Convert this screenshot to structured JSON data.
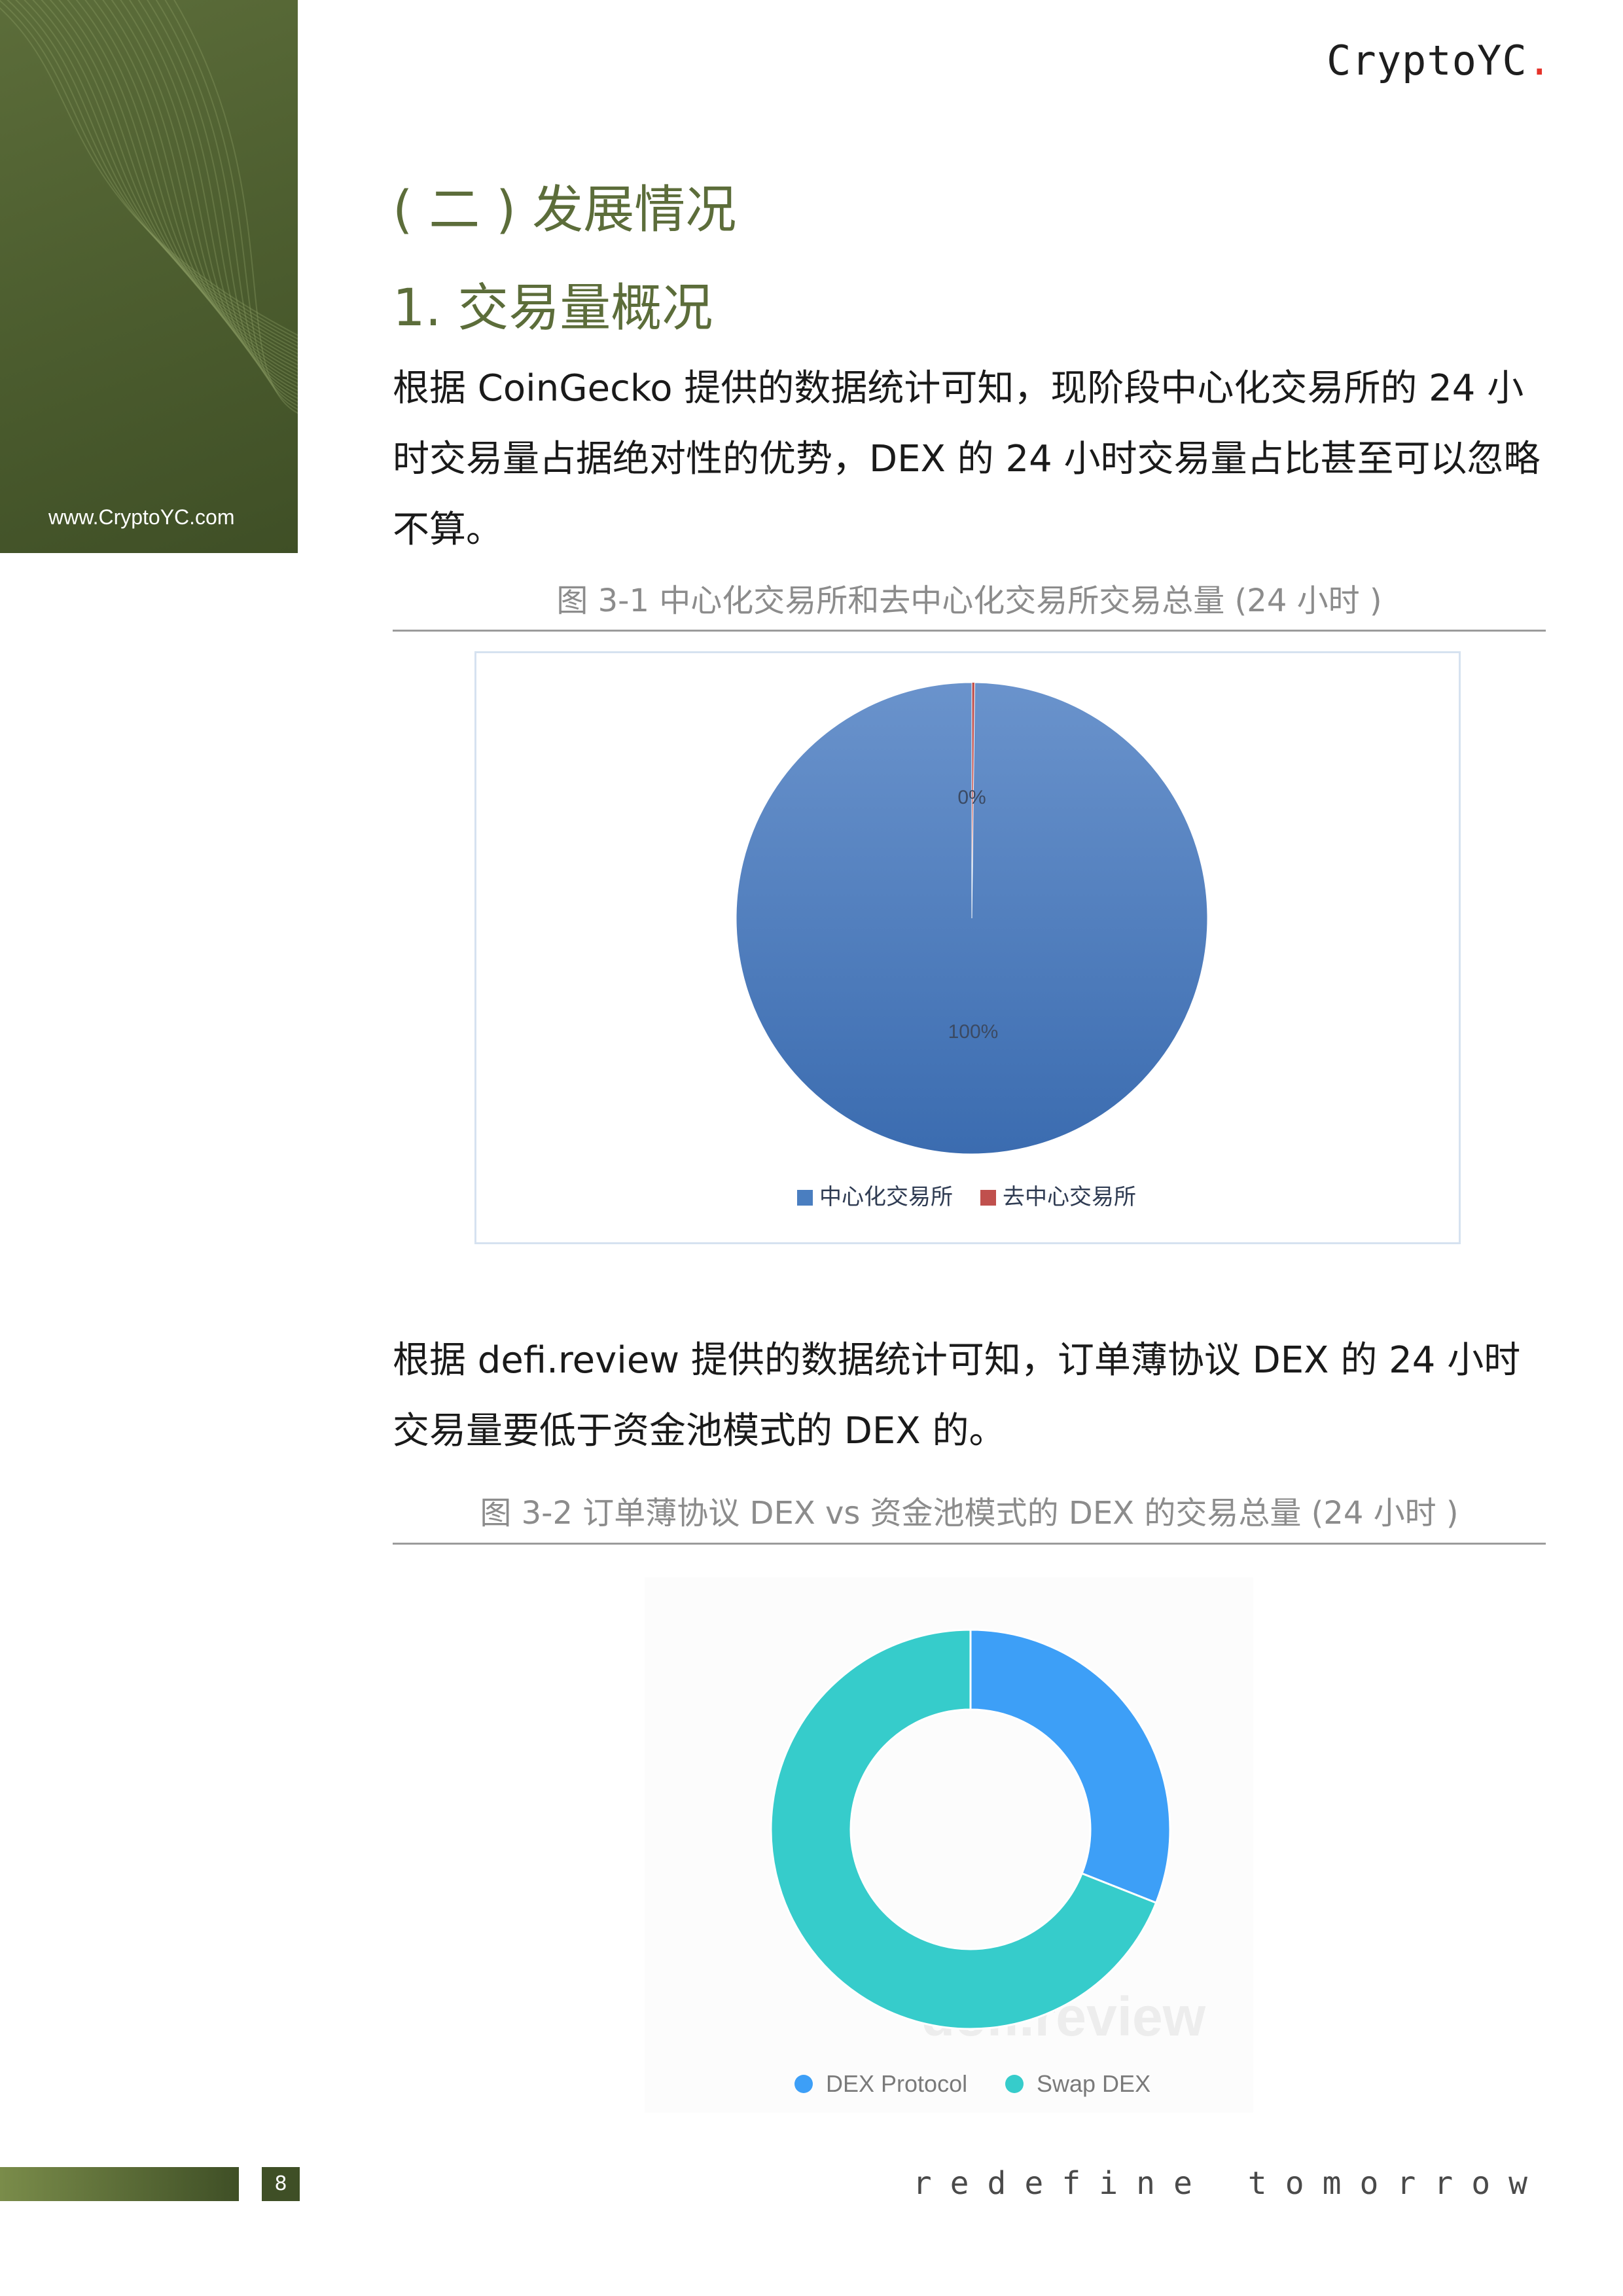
{
  "header": {
    "brand_name": "CryptoYC",
    "brand_dot": ".",
    "brand_dot_color": "#e5332a"
  },
  "sidebar": {
    "url": "www.CryptoYC.com",
    "color": "#4e5f30"
  },
  "content": {
    "section_heading": "( 二 ) 发展情况",
    "sub_heading": "1. 交易量概况",
    "para1": "根据 CoinGecko 提供的数据统计可知，现阶段中心化交易所的 24 小时交易量占据绝对性的优势，DEX 的 24 小时交易量占比甚至可以忽略不算。",
    "caption1": "图 3-1 中心化交易所和去中心化交易所交易总量 (24 小时 )",
    "para2": "根据 defi.review 提供的数据统计可知，订单薄协议 DEX 的 24 小时交易量要低于资金池模式的 DEX 的。",
    "caption2": "图 3-2 订单薄协议 DEX vs 资金池模式的 DEX 的交易总量 (24 小时 )"
  },
  "chart_data": [
    {
      "type": "pie",
      "categories": [
        "中心化交易所",
        "去中心交易所"
      ],
      "values": [
        99.8,
        0.2
      ],
      "data_labels": [
        "100%",
        "0%"
      ],
      "colors": [
        "#4a7ec0",
        "#c0504d"
      ],
      "legend": "bottom"
    },
    {
      "type": "pie",
      "categories": [
        "DEX Protocol",
        "Swap DEX"
      ],
      "values": [
        31,
        69
      ],
      "colors": [
        "#3d9ff7",
        "#36cccb"
      ],
      "donut": true,
      "watermark": "defi.review",
      "legend": "bottom"
    }
  ],
  "footer": {
    "page_number": "8",
    "tagline": "redefine tomorrow"
  }
}
